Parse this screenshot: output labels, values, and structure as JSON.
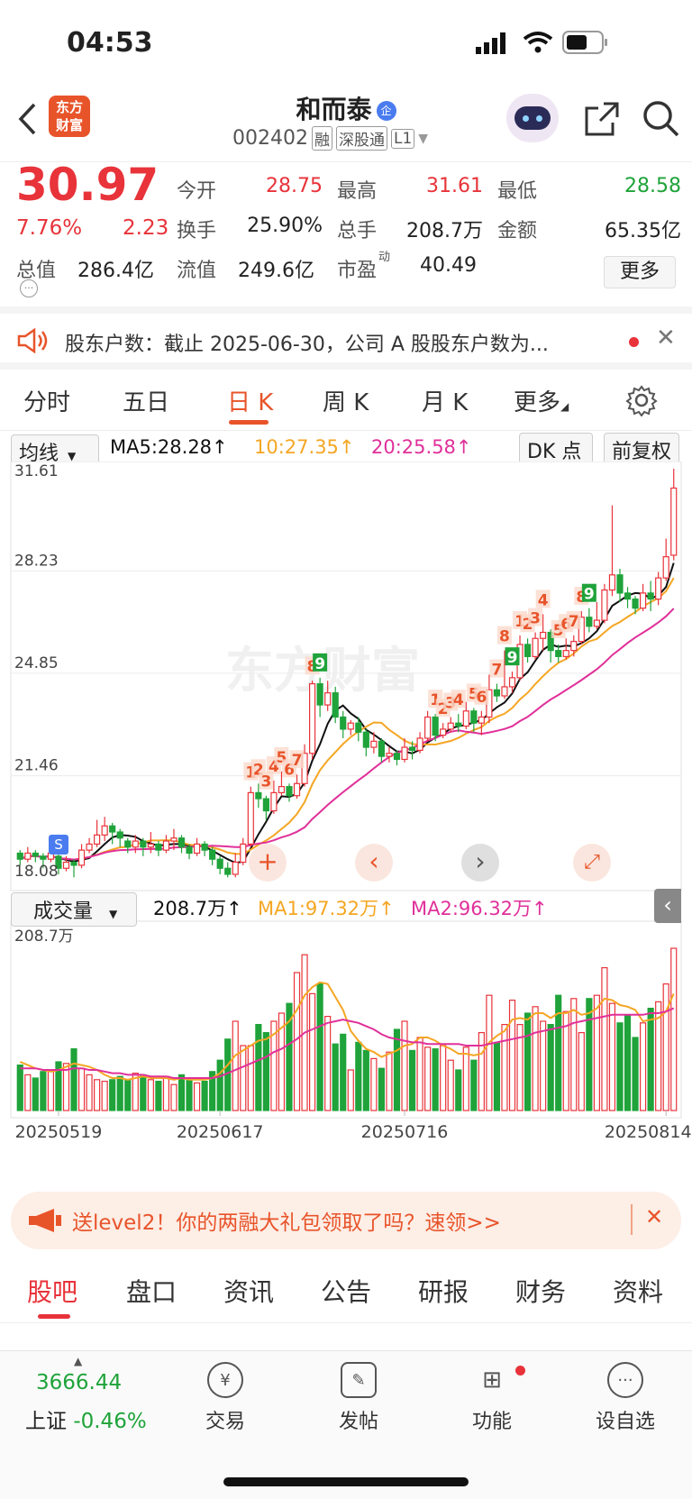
{
  "status": {
    "time": "04:53"
  },
  "header": {
    "name": "和而泰",
    "badge": "企",
    "code": "002402",
    "tags": [
      "融",
      "深股通",
      "L1"
    ],
    "logo_text": "东方\n财富"
  },
  "quote": {
    "price": "30.97",
    "change_pct": "7.76%",
    "change_amt": "2.23",
    "fields": [
      {
        "label": "今开",
        "value": "28.75",
        "color": "red"
      },
      {
        "label": "最高",
        "value": "31.61",
        "color": "red"
      },
      {
        "label": "最低",
        "value": "28.58",
        "color": "green"
      },
      {
        "label": "换手",
        "value": "25.90%",
        "color": "black"
      },
      {
        "label": "总手",
        "value": "208.7万",
        "color": "black"
      },
      {
        "label": "金额",
        "value": "65.35亿",
        "color": "black"
      },
      {
        "label": "总值",
        "value": "286.4亿",
        "color": "black"
      },
      {
        "label": "流值",
        "value": "249.6亿",
        "color": "black"
      },
      {
        "label": "市盈",
        "value": "40.49",
        "color": "black"
      }
    ],
    "pe_sup": "动",
    "more_label": "更多"
  },
  "notice": {
    "text": "股东户数：截止 2025-06-30，公司 A 股股东户数为..."
  },
  "period_tabs": [
    "分时",
    "五日",
    "日 K",
    "周 K",
    "月 K",
    "更多"
  ],
  "indicator_bar": {
    "select": "均线",
    "ma5": "MA5:28.28",
    "ma10": "10:27.35",
    "ma20": "20:25.58",
    "dk": "DK 点",
    "adjust": "前复权"
  },
  "price_axis": [
    "31.61",
    "28.23",
    "24.85",
    "21.46",
    "18.08"
  ],
  "volume_bar": {
    "select": "成交量",
    "vol": "208.7万",
    "ma1": "MA1:97.32万",
    "ma2": "MA2:96.32万",
    "top_label": "208.7万"
  },
  "date_axis": [
    "20250519",
    "20250617",
    "20250716",
    "20250814"
  ],
  "watermark": "东方财富",
  "colors": {
    "up": "#e8333a",
    "down": "#1fa33a",
    "ma5": "#111111",
    "ma10": "#f5a623",
    "ma20": "#e0309a",
    "accent": "#e8542a"
  },
  "chart_data": {
    "type": "candlestick",
    "ylim": [
      18.08,
      31.61
    ],
    "candles": [
      [
        18.9,
        18.7,
        19.0,
        18.5
      ],
      [
        18.7,
        18.9,
        19.1,
        18.6
      ],
      [
        18.9,
        18.8,
        19.0,
        18.6
      ],
      [
        18.8,
        18.7,
        18.9,
        18.4
      ],
      [
        18.7,
        18.9,
        19.1,
        18.6
      ],
      [
        18.8,
        18.4,
        18.9,
        18.2
      ],
      [
        18.4,
        18.6,
        18.8,
        18.3
      ],
      [
        18.6,
        18.5,
        18.7,
        18.1
      ],
      [
        18.5,
        19.0,
        19.2,
        18.4
      ],
      [
        19.0,
        19.2,
        19.4,
        18.9
      ],
      [
        19.2,
        19.5,
        20.0,
        19.1
      ],
      [
        19.5,
        19.8,
        20.1,
        19.3
      ],
      [
        19.8,
        19.6,
        19.9,
        19.2
      ],
      [
        19.6,
        19.4,
        19.7,
        19.1
      ],
      [
        19.3,
        19.1,
        19.4,
        18.9
      ],
      [
        19.1,
        19.3,
        19.5,
        18.9
      ],
      [
        19.3,
        19.1,
        19.4,
        18.8
      ],
      [
        19.1,
        19.2,
        19.6,
        18.9
      ],
      [
        19.2,
        19.0,
        19.3,
        18.8
      ],
      [
        19.0,
        19.3,
        19.5,
        18.9
      ],
      [
        19.3,
        19.4,
        19.7,
        19.0
      ],
      [
        19.4,
        19.1,
        19.5,
        18.9
      ],
      [
        19.1,
        18.9,
        19.2,
        18.7
      ],
      [
        18.9,
        19.2,
        19.4,
        18.8
      ],
      [
        19.2,
        19.0,
        19.3,
        18.8
      ],
      [
        19.0,
        18.7,
        19.1,
        18.5
      ],
      [
        18.7,
        18.4,
        18.8,
        18.2
      ],
      [
        18.4,
        18.2,
        18.6,
        18.1
      ],
      [
        18.2,
        18.6,
        18.9,
        18.1
      ],
      [
        18.6,
        19.2,
        19.4,
        18.5
      ],
      [
        19.2,
        20.9,
        21.1,
        19.1
      ],
      [
        20.9,
        20.7,
        21.2,
        20.4
      ],
      [
        20.7,
        20.3,
        20.8,
        20.0
      ],
      [
        20.3,
        20.9,
        21.3,
        20.2
      ],
      [
        20.9,
        21.1,
        21.6,
        20.8
      ],
      [
        21.1,
        20.8,
        21.2,
        20.6
      ],
      [
        20.8,
        21.2,
        21.5,
        20.7
      ],
      [
        21.2,
        22.2,
        22.5,
        21.1
      ],
      [
        22.2,
        24.5,
        24.6,
        22.0
      ],
      [
        24.5,
        23.8,
        24.7,
        23.4
      ],
      [
        23.8,
        24.2,
        24.6,
        23.6
      ],
      [
        24.2,
        23.4,
        24.4,
        23.2
      ],
      [
        23.4,
        23.0,
        23.6,
        22.7
      ],
      [
        23.0,
        23.2,
        23.3,
        22.8
      ],
      [
        23.2,
        22.9,
        23.4,
        22.6
      ],
      [
        22.9,
        22.4,
        23.0,
        22.1
      ],
      [
        22.4,
        22.6,
        22.9,
        22.2
      ],
      [
        22.6,
        22.1,
        22.7,
        21.9
      ],
      [
        22.1,
        22.2,
        22.4,
        21.9
      ],
      [
        22.2,
        22.0,
        22.3,
        21.8
      ],
      [
        22.0,
        22.4,
        22.7,
        21.9
      ],
      [
        22.4,
        22.3,
        22.6,
        22.0
      ],
      [
        22.3,
        22.7,
        22.9,
        22.2
      ],
      [
        22.7,
        23.4,
        23.6,
        22.6
      ],
      [
        23.4,
        22.8,
        23.5,
        22.6
      ],
      [
        22.8,
        23.0,
        23.2,
        22.7
      ],
      [
        23.0,
        23.2,
        23.4,
        22.9
      ],
      [
        23.2,
        23.1,
        23.5,
        22.9
      ],
      [
        23.1,
        23.6,
        23.9,
        23.0
      ],
      [
        23.6,
        23.2,
        23.7,
        22.9
      ],
      [
        23.2,
        23.4,
        23.6,
        22.8
      ],
      [
        23.4,
        24.3,
        24.8,
        23.2
      ],
      [
        24.3,
        24.1,
        24.5,
        23.9
      ],
      [
        24.1,
        24.4,
        25.6,
        24.0
      ],
      [
        24.4,
        24.7,
        24.9,
        24.2
      ],
      [
        24.7,
        25.8,
        26.1,
        24.6
      ],
      [
        25.8,
        25.4,
        26.0,
        25.2
      ],
      [
        25.4,
        26.0,
        26.2,
        25.3
      ],
      [
        26.0,
        26.2,
        26.8,
        25.6
      ],
      [
        26.2,
        25.6,
        26.3,
        25.2
      ],
      [
        25.6,
        25.4,
        25.8,
        25.2
      ],
      [
        25.4,
        25.6,
        26.0,
        25.3
      ],
      [
        25.6,
        25.9,
        26.1,
        25.4
      ],
      [
        25.9,
        26.7,
        26.9,
        25.8
      ],
      [
        26.7,
        26.4,
        27.0,
        26.2
      ],
      [
        26.4,
        26.6,
        27.2,
        26.3
      ],
      [
        26.6,
        27.6,
        27.8,
        26.5
      ],
      [
        27.6,
        28.1,
        30.4,
        27.4
      ],
      [
        28.1,
        27.5,
        28.3,
        27.2
      ],
      [
        27.5,
        27.3,
        27.7,
        27.0
      ],
      [
        27.3,
        27.0,
        27.4,
        26.8
      ],
      [
        27.0,
        27.5,
        27.8,
        26.9
      ],
      [
        27.5,
        27.3,
        27.9,
        26.9
      ],
      [
        27.3,
        28.0,
        28.2,
        27.1
      ],
      [
        28.0,
        28.7,
        29.3,
        27.9
      ],
      [
        28.75,
        30.97,
        31.61,
        28.58
      ]
    ],
    "volumes": [
      0.28,
      0.22,
      0.2,
      0.24,
      0.24,
      0.3,
      0.29,
      0.38,
      0.26,
      0.22,
      0.19,
      0.18,
      0.19,
      0.21,
      0.19,
      0.23,
      0.22,
      0.19,
      0.18,
      0.21,
      0.16,
      0.22,
      0.19,
      0.17,
      0.18,
      0.24,
      0.31,
      0.44,
      0.55,
      0.4,
      0.4,
      0.53,
      0.48,
      0.55,
      0.6,
      0.66,
      0.85,
      0.96,
      0.72,
      0.78,
      0.58,
      0.41,
      0.47,
      0.25,
      0.42,
      0.37,
      0.32,
      0.26,
      0.36,
      0.5,
      0.55,
      0.37,
      0.45,
      0.39,
      0.38,
      0.4,
      0.31,
      0.25,
      0.39,
      0.31,
      0.48,
      0.71,
      0.42,
      0.53,
      0.68,
      0.53,
      0.6,
      0.64,
      0.55,
      0.53,
      0.71,
      0.61,
      0.69,
      0.48,
      0.69,
      0.71,
      0.88,
      0.66,
      0.54,
      0.59,
      0.45,
      0.54,
      0.63,
      0.67,
      0.78,
      1.0
    ],
    "ma_vol1": [
      0.3,
      0.28,
      0.26,
      0.25,
      0.24,
      0.25,
      0.27,
      0.29,
      0.28,
      0.27,
      0.25,
      0.22,
      0.2,
      0.2,
      0.19,
      0.2,
      0.21,
      0.2,
      0.2,
      0.2,
      0.19,
      0.2,
      0.19,
      0.19,
      0.19,
      0.2,
      0.23,
      0.28,
      0.34,
      0.37,
      0.4,
      0.43,
      0.44,
      0.47,
      0.51,
      0.55,
      0.62,
      0.71,
      0.76,
      0.79,
      0.78,
      0.7,
      0.62,
      0.49,
      0.43,
      0.38,
      0.36,
      0.33,
      0.35,
      0.37,
      0.4,
      0.41,
      0.45,
      0.45,
      0.43,
      0.4,
      0.38,
      0.35,
      0.35,
      0.34,
      0.35,
      0.42,
      0.46,
      0.49,
      0.56,
      0.57,
      0.56,
      0.6,
      0.6,
      0.57,
      0.6,
      0.6,
      0.62,
      0.59,
      0.6,
      0.63,
      0.69,
      0.68,
      0.65,
      0.64,
      0.62,
      0.55,
      0.56,
      0.57,
      0.61,
      0.72
    ],
    "ma_vol2": [
      0.26,
      0.26,
      0.26,
      0.25,
      0.25,
      0.25,
      0.25,
      0.26,
      0.26,
      0.25,
      0.25,
      0.24,
      0.23,
      0.23,
      0.22,
      0.22,
      0.22,
      0.21,
      0.21,
      0.21,
      0.2,
      0.2,
      0.2,
      0.2,
      0.2,
      0.2,
      0.21,
      0.23,
      0.25,
      0.27,
      0.29,
      0.31,
      0.33,
      0.36,
      0.38,
      0.41,
      0.44,
      0.48,
      0.5,
      0.52,
      0.54,
      0.55,
      0.56,
      0.55,
      0.54,
      0.52,
      0.5,
      0.47,
      0.45,
      0.44,
      0.43,
      0.42,
      0.42,
      0.41,
      0.41,
      0.41,
      0.41,
      0.41,
      0.4,
      0.4,
      0.4,
      0.41,
      0.42,
      0.43,
      0.44,
      0.45,
      0.46,
      0.48,
      0.49,
      0.5,
      0.51,
      0.52,
      0.54,
      0.55,
      0.56,
      0.57,
      0.58,
      0.59,
      0.59,
      0.59,
      0.59,
      0.59,
      0.6,
      0.6,
      0.61,
      0.63
    ],
    "signal_labels": [
      {
        "i": 30,
        "t": "1"
      },
      {
        "i": 31,
        "t": "2"
      },
      {
        "i": 32,
        "t": "3"
      },
      {
        "i": 33,
        "t": "4"
      },
      {
        "i": 34,
        "t": "5"
      },
      {
        "i": 35,
        "t": "6"
      },
      {
        "i": 36,
        "t": "7"
      },
      {
        "i": 38,
        "t": "8"
      },
      {
        "i": 39,
        "t": "9"
      },
      {
        "i": 54,
        "t": "1"
      },
      {
        "i": 55,
        "t": "2"
      },
      {
        "i": 56,
        "t": "3"
      },
      {
        "i": 57,
        "t": "4"
      },
      {
        "i": 59,
        "t": "5"
      },
      {
        "i": 60,
        "t": "6"
      },
      {
        "i": 62,
        "t": "7"
      },
      {
        "i": 63,
        "t": "8"
      },
      {
        "i": 64,
        "t": "9"
      },
      {
        "i": 65,
        "t": "1"
      },
      {
        "i": 66,
        "t": "2"
      },
      {
        "i": 67,
        "t": "3"
      },
      {
        "i": 68,
        "t": "4"
      },
      {
        "i": 70,
        "t": "5"
      },
      {
        "i": 71,
        "t": "6"
      },
      {
        "i": 72,
        "t": "7"
      },
      {
        "i": 73,
        "t": "8"
      },
      {
        "i": 74,
        "t": "9"
      }
    ]
  },
  "promo": {
    "text": "送level2！你的两融大礼包领取了吗？速领>>"
  },
  "bottom_tabs": [
    "股吧",
    "盘口",
    "资讯",
    "公告",
    "研报",
    "财务",
    "资料"
  ],
  "bottom_nav": {
    "index_value": "3666.44",
    "index_name": "上证",
    "index_change": "-0.46%",
    "items": [
      {
        "label": "交易",
        "icon": "yen-icon"
      },
      {
        "label": "发帖",
        "icon": "edit-icon"
      },
      {
        "label": "功能",
        "icon": "grid-icon"
      },
      {
        "label": "设自选",
        "icon": "more-icon"
      }
    ]
  }
}
